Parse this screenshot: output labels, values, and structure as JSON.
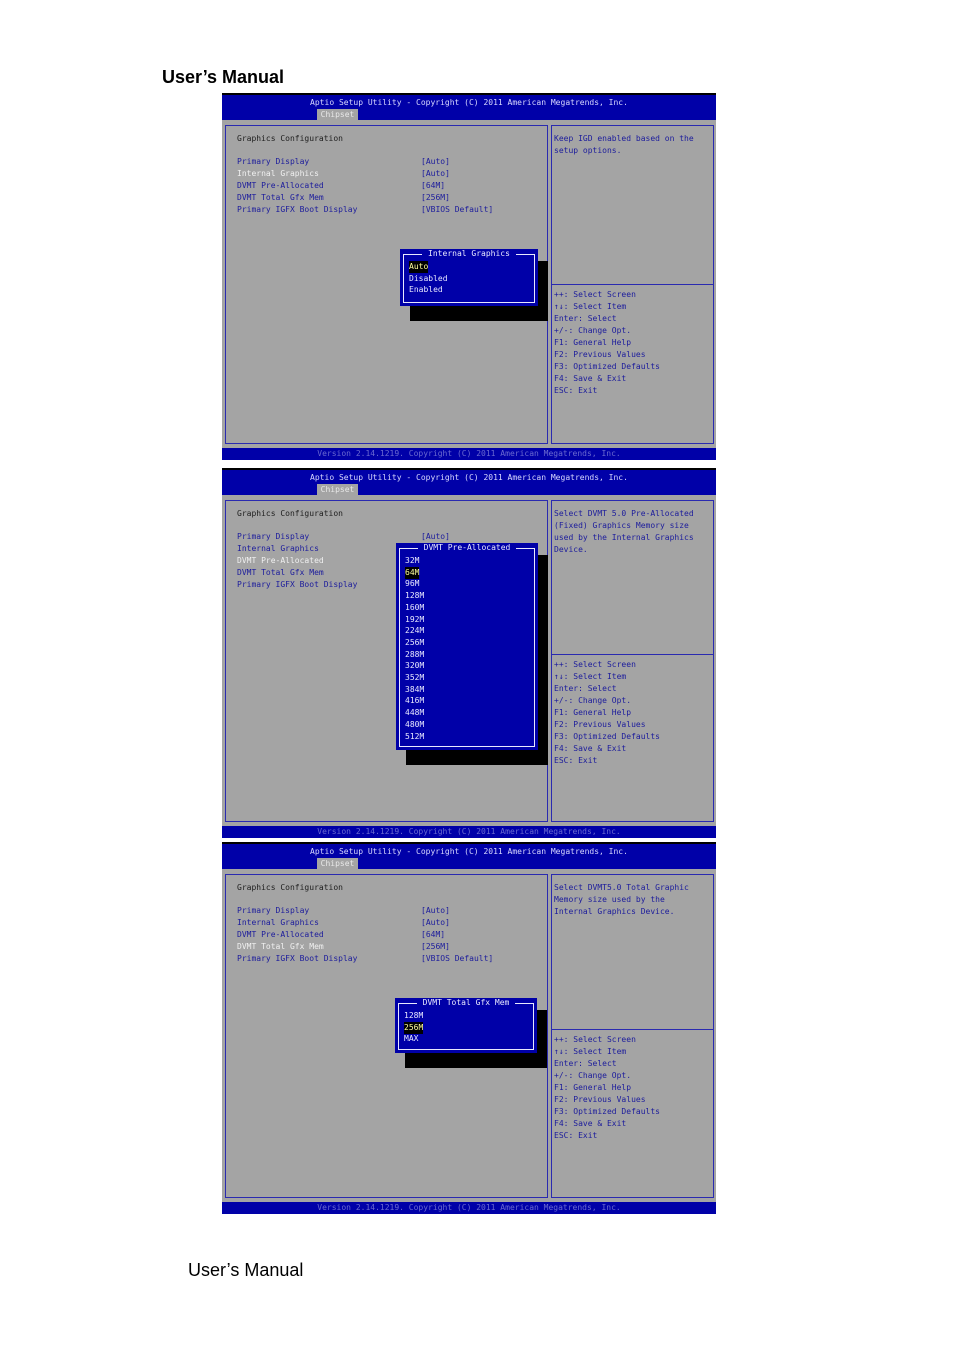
{
  "header": "User’s Manual",
  "footer": "User’s Manual",
  "colors": {
    "bios_blue": "#0000a8",
    "bios_gray": "#a4a4a4",
    "text_blue": "#1c1c9c"
  },
  "screens": [
    {
      "title": "Aptio Setup Utility - Copyright (C) 2011 American Megatrends, Inc.",
      "tab": "Chipset",
      "section": "Graphics Configuration",
      "items": [
        {
          "label": "Primary Display",
          "value": "[Auto]"
        },
        {
          "label": "Internal Graphics",
          "value": "[Auto]"
        },
        {
          "label": "DVMT Pre-Allocated",
          "value": "[64M]"
        },
        {
          "label": "DVMT Total Gfx Mem",
          "value": "[256M]"
        },
        {
          "label": "Primary IGFX Boot Display",
          "value": "[VBIOS Default]"
        }
      ],
      "selected_item": 1,
      "help": [
        "Keep IGD enabled based on the",
        "setup options."
      ],
      "keys": [
        "++: Select Screen",
        "↑↓: Select Item",
        "Enter: Select",
        "+/-: Change Opt.",
        "F1: General Help",
        "F2: Previous Values",
        "F3: Optimized Defaults",
        "F4: Save & Exit",
        "ESC: Exit"
      ],
      "popup": {
        "title": "Internal Graphics",
        "options": [
          "Auto",
          "Disabled",
          "Enabled"
        ],
        "selected": 0
      },
      "version": "Version 2.14.1219. Copyright (C) 2011 American Megatrends, Inc."
    },
    {
      "title": "Aptio Setup Utility - Copyright (C) 2011 American Megatrends, Inc.",
      "tab": "Chipset",
      "section": "Graphics Configuration",
      "items": [
        {
          "label": "Primary Display",
          "value": "[Auto]"
        },
        {
          "label": "Internal Graphics",
          "value": ""
        },
        {
          "label": "DVMT Pre-Allocated",
          "value": ""
        },
        {
          "label": "DVMT Total Gfx Mem",
          "value": ""
        },
        {
          "label": "Primary IGFX Boot Display",
          "value": ""
        }
      ],
      "selected_item": 2,
      "help": [
        "Select DVMT 5.0 Pre-Allocated",
        "(Fixed) Graphics Memory size",
        "used by the Internal Graphics",
        "Device."
      ],
      "keys": [
        "++: Select Screen",
        "↑↓: Select Item",
        "Enter: Select",
        "+/-: Change Opt.",
        "F1: General Help",
        "F2: Previous Values",
        "F3: Optimized Defaults",
        "F4: Save & Exit",
        "ESC: Exit"
      ],
      "popup": {
        "title": "DVMT Pre-Allocated",
        "options": [
          "32M",
          "64M",
          "96M",
          "128M",
          "160M",
          "192M",
          "224M",
          "256M",
          "288M",
          "320M",
          "352M",
          "384M",
          "416M",
          "448M",
          "480M",
          "512M"
        ],
        "selected": 1
      },
      "version": "Version 2.14.1219. Copyright (C) 2011 American Megatrends, Inc."
    },
    {
      "title": "Aptio Setup Utility - Copyright (C) 2011 American Megatrends, Inc.",
      "tab": "Chipset",
      "section": "Graphics Configuration",
      "items": [
        {
          "label": "Primary Display",
          "value": "[Auto]"
        },
        {
          "label": "Internal Graphics",
          "value": "[Auto]"
        },
        {
          "label": "DVMT Pre-Allocated",
          "value": "[64M]"
        },
        {
          "label": "DVMT Total Gfx Mem",
          "value": "[256M]"
        },
        {
          "label": "Primary IGFX Boot Display",
          "value": "[VBIOS Default]"
        }
      ],
      "selected_item": 3,
      "help": [
        "Select DVMT5.0 Total Graphic",
        "Memory size used by the",
        "Internal Graphics Device."
      ],
      "keys": [
        "++: Select Screen",
        "↑↓: Select Item",
        "Enter: Select",
        "+/-: Change Opt.",
        "F1: General Help",
        "F2: Previous Values",
        "F3: Optimized Defaults",
        "F4: Save & Exit",
        "ESC: Exit"
      ],
      "popup": {
        "title": "DVMT Total Gfx Mem",
        "options": [
          "128M",
          "256M",
          "MAX"
        ],
        "selected": 1
      },
      "version": "Version 2.14.1219. Copyright (C) 2011 American Megatrends, Inc."
    }
  ]
}
